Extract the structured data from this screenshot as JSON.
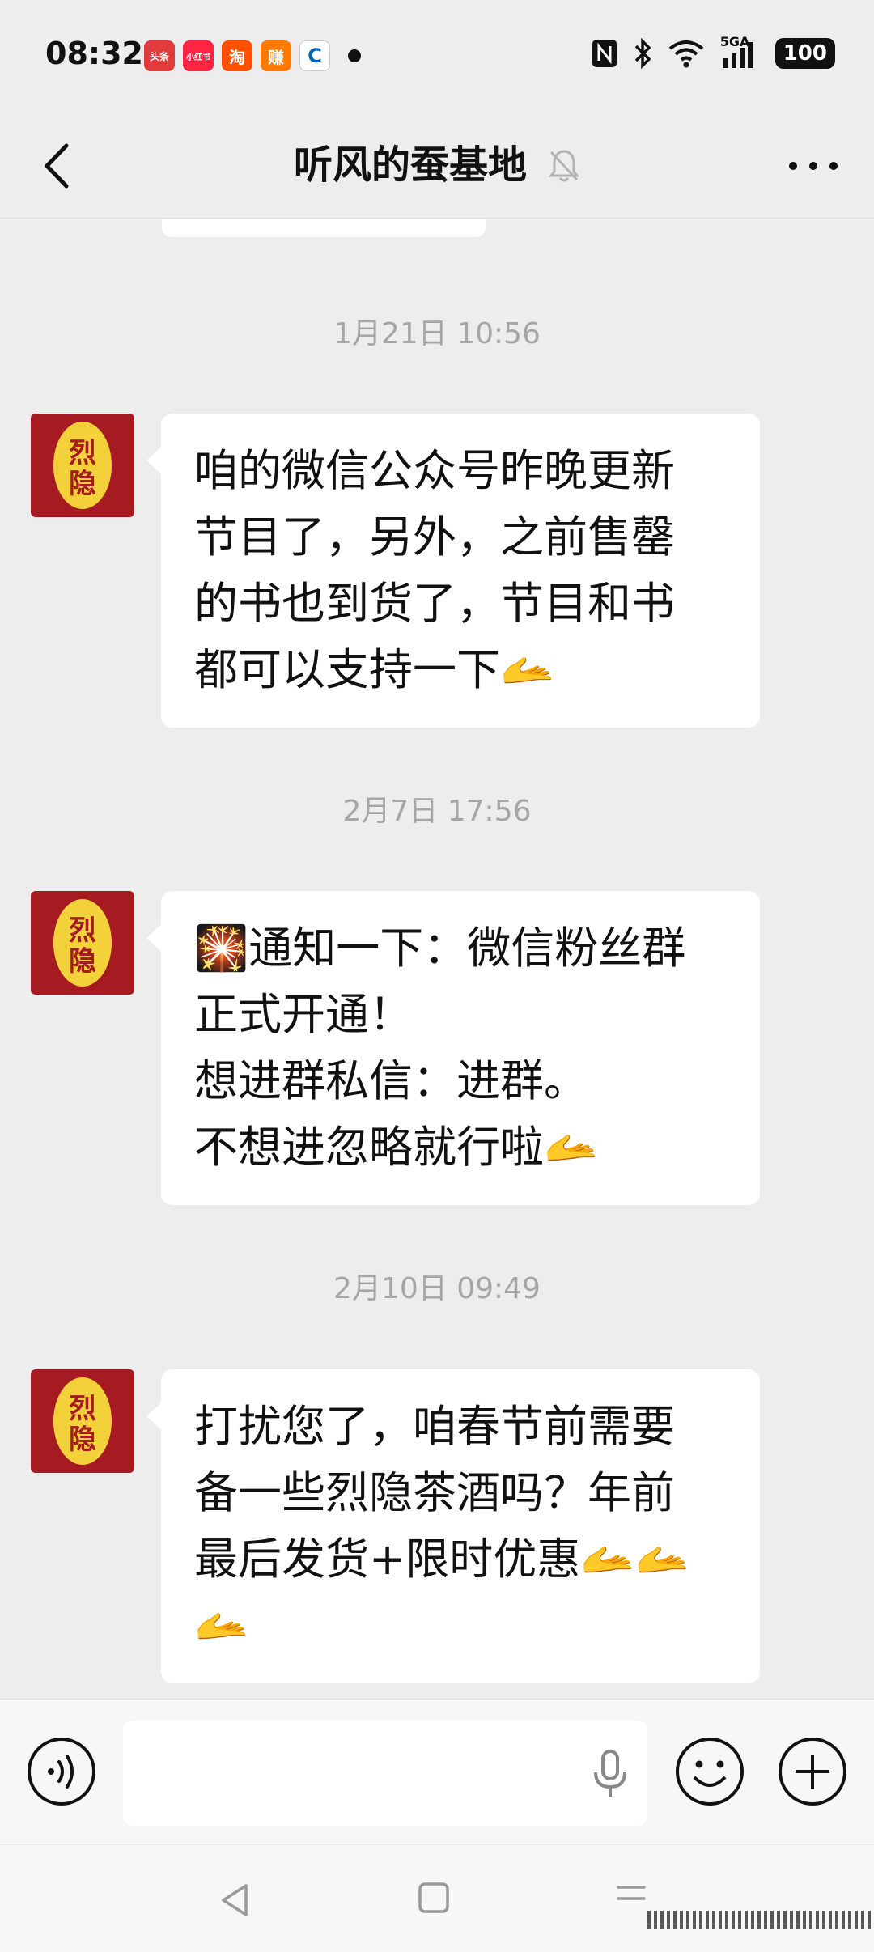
{
  "status_bar": {
    "time": "08:32",
    "notification_apps": [
      {
        "label": "头条",
        "color": "#e23b3b"
      },
      {
        "label": "小红书",
        "color": "#ff2442"
      },
      {
        "label": "淘",
        "color": "#ff5000"
      },
      {
        "label": "赚",
        "color": "#ff7a00"
      },
      {
        "label": "C",
        "color": "#0060b6"
      }
    ],
    "network": "5GA",
    "battery": "100"
  },
  "header": {
    "title": "听风的蚕基地",
    "muted_icon": "bell-off-icon"
  },
  "messages": [
    {
      "timestamp": "1月21日 10:56",
      "text": "咱的微信公众号昨晚更新\n节目了，另外，之前售罄\n的书也到货了，节目和书\n都可以支持一下🫴"
    },
    {
      "timestamp": "2月7日 17:56",
      "text": "🎇通知一下：微信粉丝群\n正式开通！\n想进群私信：进群。\n不想进忽略就行啦🫴"
    },
    {
      "timestamp": "2月10日 09:49",
      "text": "打扰您了，咱春节前需要\n备一些烈隐茶酒吗？年前\n最后发货+限时优惠🫴🫴\n🫴"
    }
  ],
  "avatar": {
    "text": "烈隐",
    "bg": "#a61b22",
    "fg": "#f2d13a"
  },
  "input_bar": {
    "value": ""
  },
  "colors": {
    "background": "#ededed",
    "bubble": "#ffffff",
    "timestamp": "#a6a6a6"
  }
}
